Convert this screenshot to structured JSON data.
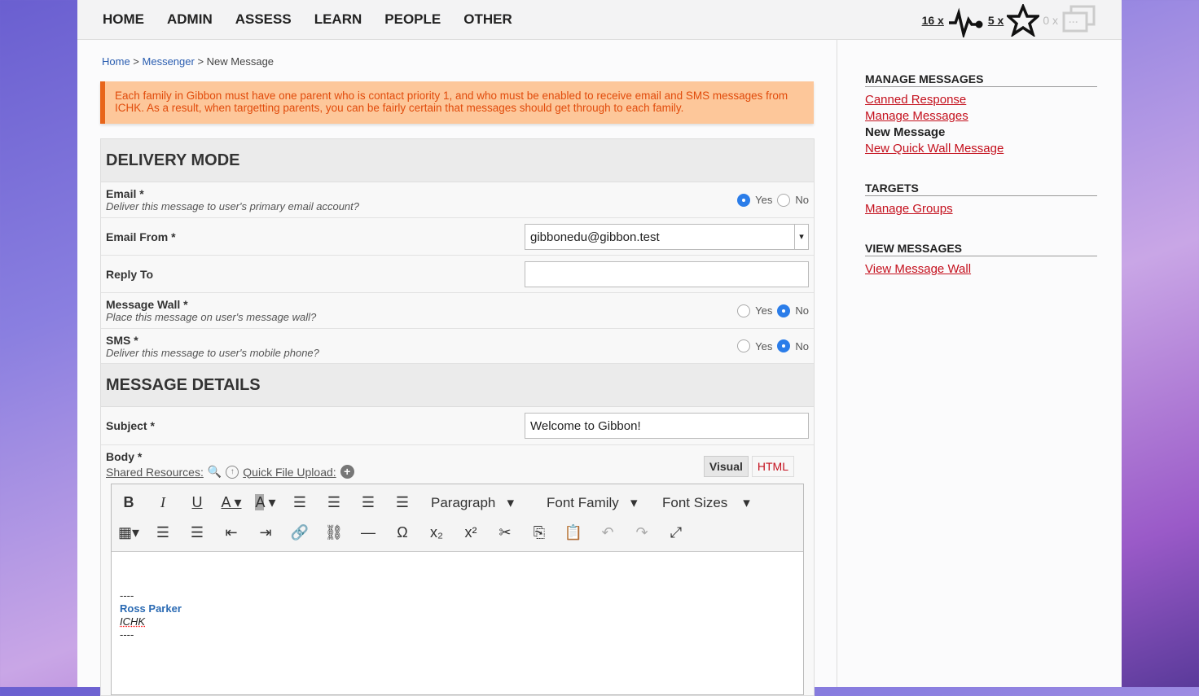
{
  "nav": [
    "HOME",
    "ADMIN",
    "ASSESS",
    "LEARN",
    "PEOPLE",
    "OTHER"
  ],
  "notifications": {
    "likes": "16 x",
    "stars": "5 x",
    "messages": "0 x"
  },
  "breadcrumb": {
    "home": "Home",
    "messenger": "Messenger",
    "current": "New Message",
    "sep": " > "
  },
  "warning": "Each family in Gibbon must have one parent who is contact priority 1, and who must be enabled to receive email and SMS messages from ICHK. As a result, when targetting parents, you can be fairly certain that messages should get through to each family.",
  "delivery": {
    "title": "DELIVERY MODE",
    "email": {
      "label": "Email *",
      "desc": "Deliver this message to user's primary email account?",
      "value": "Yes"
    },
    "email_from": {
      "label": "Email From *",
      "value": "gibbonedu@gibbon.test"
    },
    "reply_to": {
      "label": "Reply To",
      "value": ""
    },
    "wall": {
      "label": "Message Wall *",
      "desc": "Place this message on user's message wall?",
      "value": "No"
    },
    "sms": {
      "label": "SMS *",
      "desc": "Deliver this message to user's mobile phone?",
      "value": "No"
    },
    "yes": "Yes",
    "no": "No"
  },
  "details": {
    "title": "MESSAGE DETAILS",
    "subject_label": "Subject *",
    "subject": "Welcome to Gibbon!",
    "body_label": "Body *",
    "shared": "Shared Resources:",
    "quick": "Quick File Upload:",
    "tab_visual": "Visual",
    "tab_html": "HTML",
    "toolbar": {
      "paragraph": "Paragraph",
      "font_family": "Font Family",
      "font_sizes": "Font Sizes"
    },
    "content": {
      "sep1": "----",
      "name": "Ross Parker",
      "org": "ICHK",
      "sep2": "----"
    }
  },
  "sidebar": [
    {
      "title": "MANAGE MESSAGES",
      "items": [
        "Canned Response",
        "Manage Messages",
        "New Message",
        "New Quick Wall Message"
      ],
      "current": "New Message"
    },
    {
      "title": "TARGETS",
      "items": [
        "Manage Groups"
      ]
    },
    {
      "title": "VIEW MESSAGES",
      "items": [
        "View Message Wall"
      ]
    }
  ],
  "colors": {
    "link": "#c4101d",
    "warning_bg": "#fdc79a",
    "warning_text": "#e14b0b",
    "radio": "#2b7de9"
  }
}
